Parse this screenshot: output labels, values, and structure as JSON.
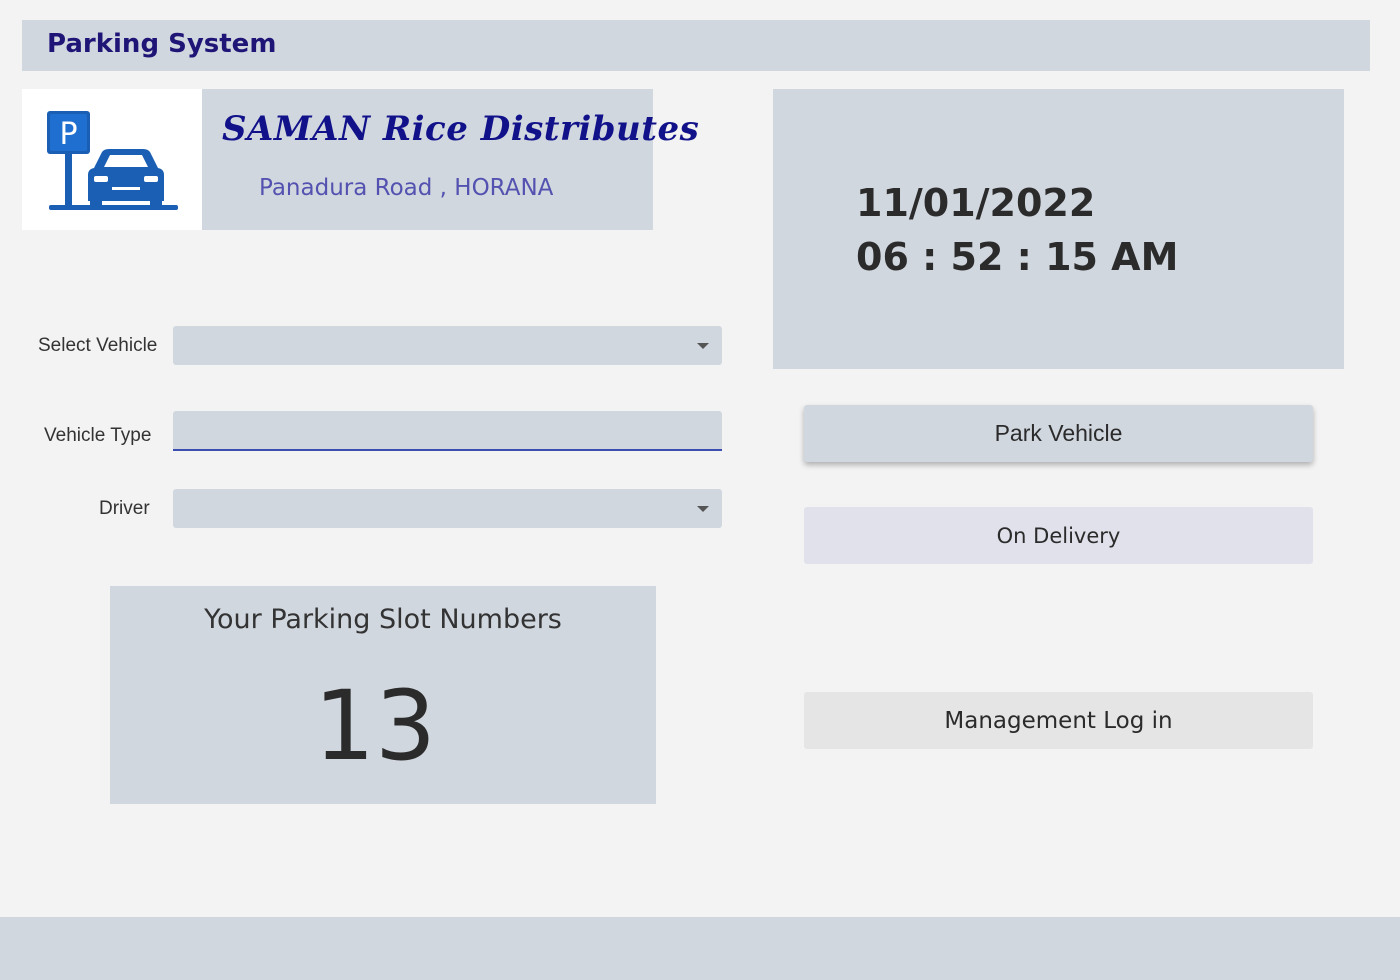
{
  "window": {
    "title": "Parking System"
  },
  "company": {
    "name": "SAMAN Rice Distributes",
    "address": "Panadura Road , HORANA",
    "logo_icon": "parking-car-icon"
  },
  "clock": {
    "date": "11/01/2022",
    "time": "06 : 52 : 15 AM"
  },
  "form": {
    "select_vehicle_label": "Select Vehicle",
    "select_vehicle_value": "",
    "vehicle_type_label": "Vehicle Type",
    "vehicle_type_value": "",
    "driver_label": "Driver",
    "driver_value": ""
  },
  "buttons": {
    "park_vehicle": "Park Vehicle",
    "on_delivery": "On Delivery",
    "management_login": "Management Log in"
  },
  "slot": {
    "title": "Your Parking Slot Numbers",
    "number": "13"
  },
  "colors": {
    "panel": "#d1d7df",
    "title_text": "#1f1577",
    "company_name": "#11118a",
    "address_text": "#5452b0",
    "logo_blue": "#1a5fb4",
    "input_underline": "#3b4eb0"
  }
}
